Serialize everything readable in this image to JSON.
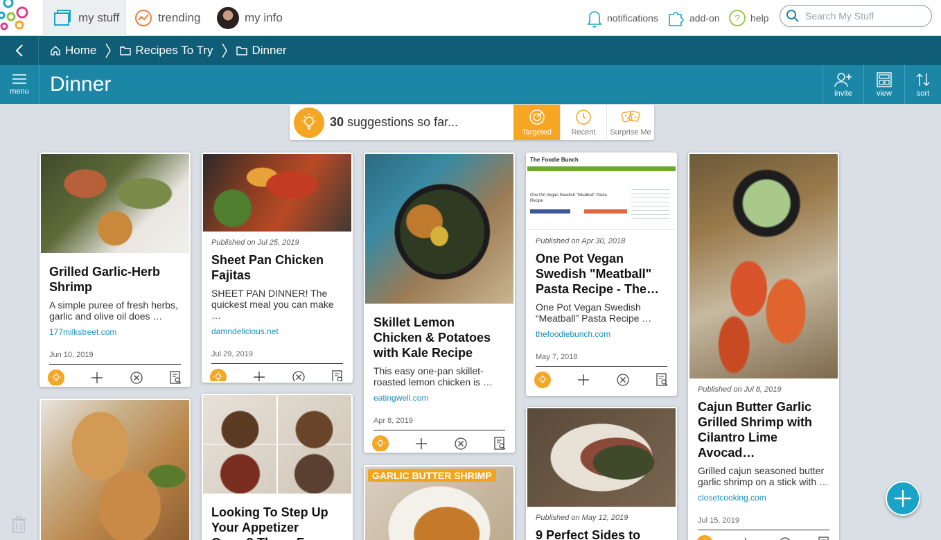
{
  "topbar": {
    "tabs": [
      {
        "label": "my stuff",
        "icon": "folder-icon"
      },
      {
        "label": "trending",
        "icon": "trending-icon"
      },
      {
        "label": "my info",
        "icon": "avatar"
      }
    ],
    "notifications": "notifications",
    "addon": "add-on",
    "help": "help",
    "search_placeholder": "Search My Stuff"
  },
  "breadcrumb": {
    "items": [
      "Home",
      "Recipes To Try",
      "Dinner"
    ]
  },
  "titlebar": {
    "menu": "menu",
    "title": "Dinner",
    "invite": "invite",
    "view": "view",
    "sort": "sort"
  },
  "suggestions": {
    "count": "30",
    "text": "suggestions so far...",
    "tabs": [
      "Targeted",
      "Recent",
      "Surprise Me"
    ]
  },
  "cards": [
    {
      "title": "Grilled Garlic-Herb Shrimp",
      "desc": "A simple puree of fresh herbs, garlic and olive oil does …",
      "source": "177milkstreet.com",
      "date": "Jun 10, 2019",
      "published": ""
    },
    {
      "title": "Sheet Pan Chicken Fajitas",
      "desc": "SHEET PAN DINNER! The quickest meal you can make …",
      "source": "damndelicious.net",
      "date": "Jul 29, 2019",
      "published": "Published on Jul 25, 2019"
    },
    {
      "title": "Skillet Lemon Chicken & Potatoes with Kale Recipe",
      "desc": "This easy one-pan skillet-roasted lemon chicken is …",
      "source": "eatingwell.com",
      "date": "Apr 8, 2019",
      "published": ""
    },
    {
      "title": "One Pot Vegan Swedish \"Meatball\" Pasta Recipe - The…",
      "desc": "One Pot Vegan Swedish “Meatball” Pasta Recipe …",
      "source": "thefoodiebunch.com",
      "date": "May 7, 2018",
      "published": "Published on Apr 30, 2018"
    },
    {
      "title": "Cajun Butter Garlic Grilled Shrimp with Cilantro Lime Avocad…",
      "desc": "Grilled cajun seasoned butter garlic shrimp on a stick with …",
      "source": "closetcooking.com",
      "date": "Jul 15, 2019",
      "published": "Published on Jul 8, 2019"
    },
    {
      "title": "",
      "desc": "",
      "source": "",
      "date": "",
      "published": ""
    },
    {
      "title": "Looking To Step Up Your Appetizer Game? These Four Mini…",
      "desc": "",
      "source": "",
      "date": "",
      "published": ""
    },
    {
      "title": "",
      "desc": "",
      "source": "",
      "date": "",
      "published": "",
      "banner": "GARLIC BUTTER SHRIMP"
    },
    {
      "title": "9 Perfect Sides to",
      "desc": "",
      "source": "",
      "date": "",
      "published": "Published on May 12, 2019"
    }
  ],
  "foodie_screenshot": {
    "site": "The Foodie Bunch",
    "heading": "One Pot Vegan Swedish \"Meatball\" Pasta Recipe"
  },
  "colors": {
    "accent": "#f5a623",
    "header": "#0f5d76",
    "titlebar": "#1b86a6",
    "link": "#1a8fb7"
  }
}
